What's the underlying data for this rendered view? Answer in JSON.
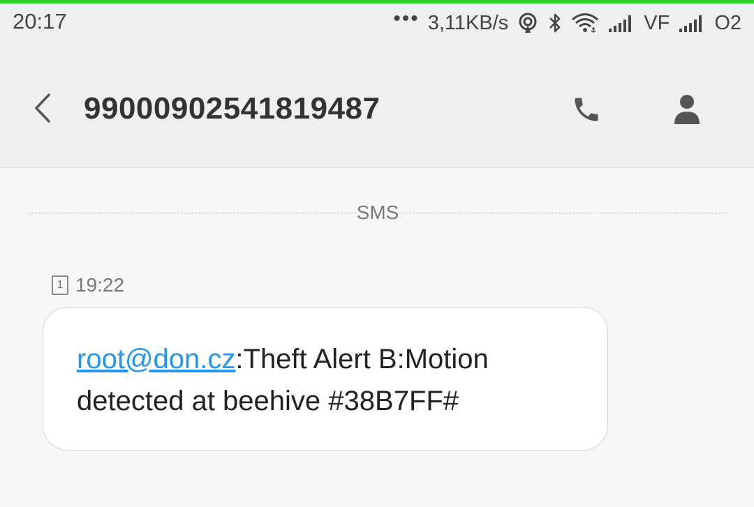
{
  "status_bar": {
    "time": "20:17",
    "more": "•••",
    "net_speed": "3,11KB/s",
    "carrier1": "VF",
    "carrier2": "O2",
    "icons": [
      "hotspot-icon",
      "bluetooth-icon",
      "wifi-icon",
      "signal-icon",
      "signal-icon"
    ]
  },
  "toolbar": {
    "title": "99000902541819487",
    "back_icon": "chevron-left-icon",
    "call_icon": "phone-icon",
    "contact_icon": "person-icon"
  },
  "thread": {
    "divider_label": "SMS",
    "message": {
      "sim": "1",
      "time": "19:22",
      "sender_link": "root@don.cz",
      "body": ":Theft Alert B:Motion detected at beehive #38B7FF#"
    }
  },
  "colors": {
    "accent_bar": "#2fd42a",
    "link": "#2196f3",
    "header_bg": "#eeefee",
    "page_bg": "#f7f7f7"
  }
}
